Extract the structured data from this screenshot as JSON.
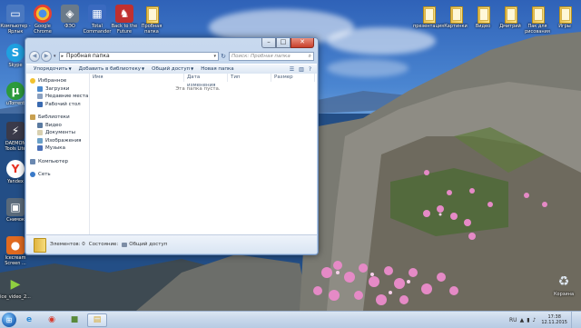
{
  "desktop": {
    "left_icons": [
      {
        "label": "Компьютер - Ярлык",
        "icon": "computer-icon",
        "color": "#4a78c0",
        "glyph": "▭"
      },
      {
        "label": "Skype",
        "icon": "skype-icon",
        "color": "#1fa0e0",
        "glyph": "S"
      },
      {
        "label": "uTorrent",
        "icon": "utorrent-icon",
        "color": "#2c9a3c",
        "glyph": "µ"
      },
      {
        "label": "DAEMON Tools Lite",
        "icon": "daemon-tools-icon",
        "color": "#3a3a4a",
        "glyph": "⚡"
      },
      {
        "label": "Yandex",
        "icon": "yandex-icon",
        "color": "#e83020",
        "glyph": "Y"
      },
      {
        "label": "Снимок",
        "icon": "screenshot-icon",
        "color": "#5a6a7a",
        "glyph": "▣"
      },
      {
        "label": "Icecream Screen ...",
        "icon": "icecream-recorder-icon",
        "color": "#e06a20",
        "glyph": "●"
      },
      {
        "label": "ice_video_2...",
        "icon": "video-file-icon",
        "color": "#6cae2c",
        "glyph": "▶"
      }
    ],
    "top_icons": [
      {
        "label": "Google Chrome",
        "icon": "chrome-icon",
        "color": "#e84030",
        "glyph": "◉"
      },
      {
        "label": "ФЭО",
        "icon": "app-icon",
        "color": "#6a7a8a",
        "glyph": "◈"
      },
      {
        "label": "Total Commander",
        "icon": "total-commander-icon",
        "color": "#3a6ac0",
        "glyph": "▦"
      },
      {
        "label": "Back to the Future",
        "icon": "game-icon",
        "color": "#c03030",
        "glyph": "♞"
      },
      {
        "label": "Пробная папка",
        "icon": "folder-icon",
        "color": "",
        "glyph": ""
      }
    ],
    "right_icons": [
      {
        "label": "презентация",
        "icon": "folder-icon"
      },
      {
        "label": "Картинки",
        "icon": "folder-icon"
      },
      {
        "label": "Видео",
        "icon": "folder-icon"
      },
      {
        "label": "Дмитрий",
        "icon": "folder-icon"
      },
      {
        "label": "Пак для рисования",
        "icon": "folder-icon"
      },
      {
        "label": "Игры",
        "icon": "folder-icon"
      }
    ],
    "trash": {
      "label": "Корзина",
      "icon": "recycle-bin-icon"
    }
  },
  "window": {
    "address": {
      "path": "Пробная папка"
    },
    "search": {
      "placeholder": "Поиск: Пробная папка"
    },
    "toolbar": {
      "organize": "Упорядочить",
      "add_to_library": "Добавить в библиотеку",
      "share": "Общий доступ",
      "new_folder": "Новая папка"
    },
    "nav": {
      "favorites": "Избранное",
      "favorites_items": [
        "Загрузки",
        "Недавние места",
        "Рабочий стол"
      ],
      "libraries": "Библиотеки",
      "libraries_items": [
        "Видео",
        "Документы",
        "Изображения",
        "Музыка"
      ],
      "computer": "Компьютер",
      "network": "Сеть"
    },
    "columns": [
      "Имя",
      "Дата изменения",
      "Тип",
      "Размер"
    ],
    "empty_message": "Эта папка пуста.",
    "details": {
      "items_label": "Элементов: 0",
      "state_label": "Состояние:",
      "state_value": "Общий доступ"
    }
  },
  "taskbar": {
    "apps": [
      {
        "icon": "internet-explorer-icon",
        "glyph": "e",
        "color": "#2a8ad8"
      },
      {
        "icon": "chrome-icon",
        "glyph": "◉",
        "color": "#d83a2c"
      },
      {
        "icon": "minecraft-icon",
        "glyph": "■",
        "color": "#5a8a3a"
      },
      {
        "icon": "explorer-icon",
        "glyph": "▤",
        "color": "#d8a830"
      }
    ],
    "language": "RU",
    "time": "17:38",
    "date": "12.11.2015"
  }
}
